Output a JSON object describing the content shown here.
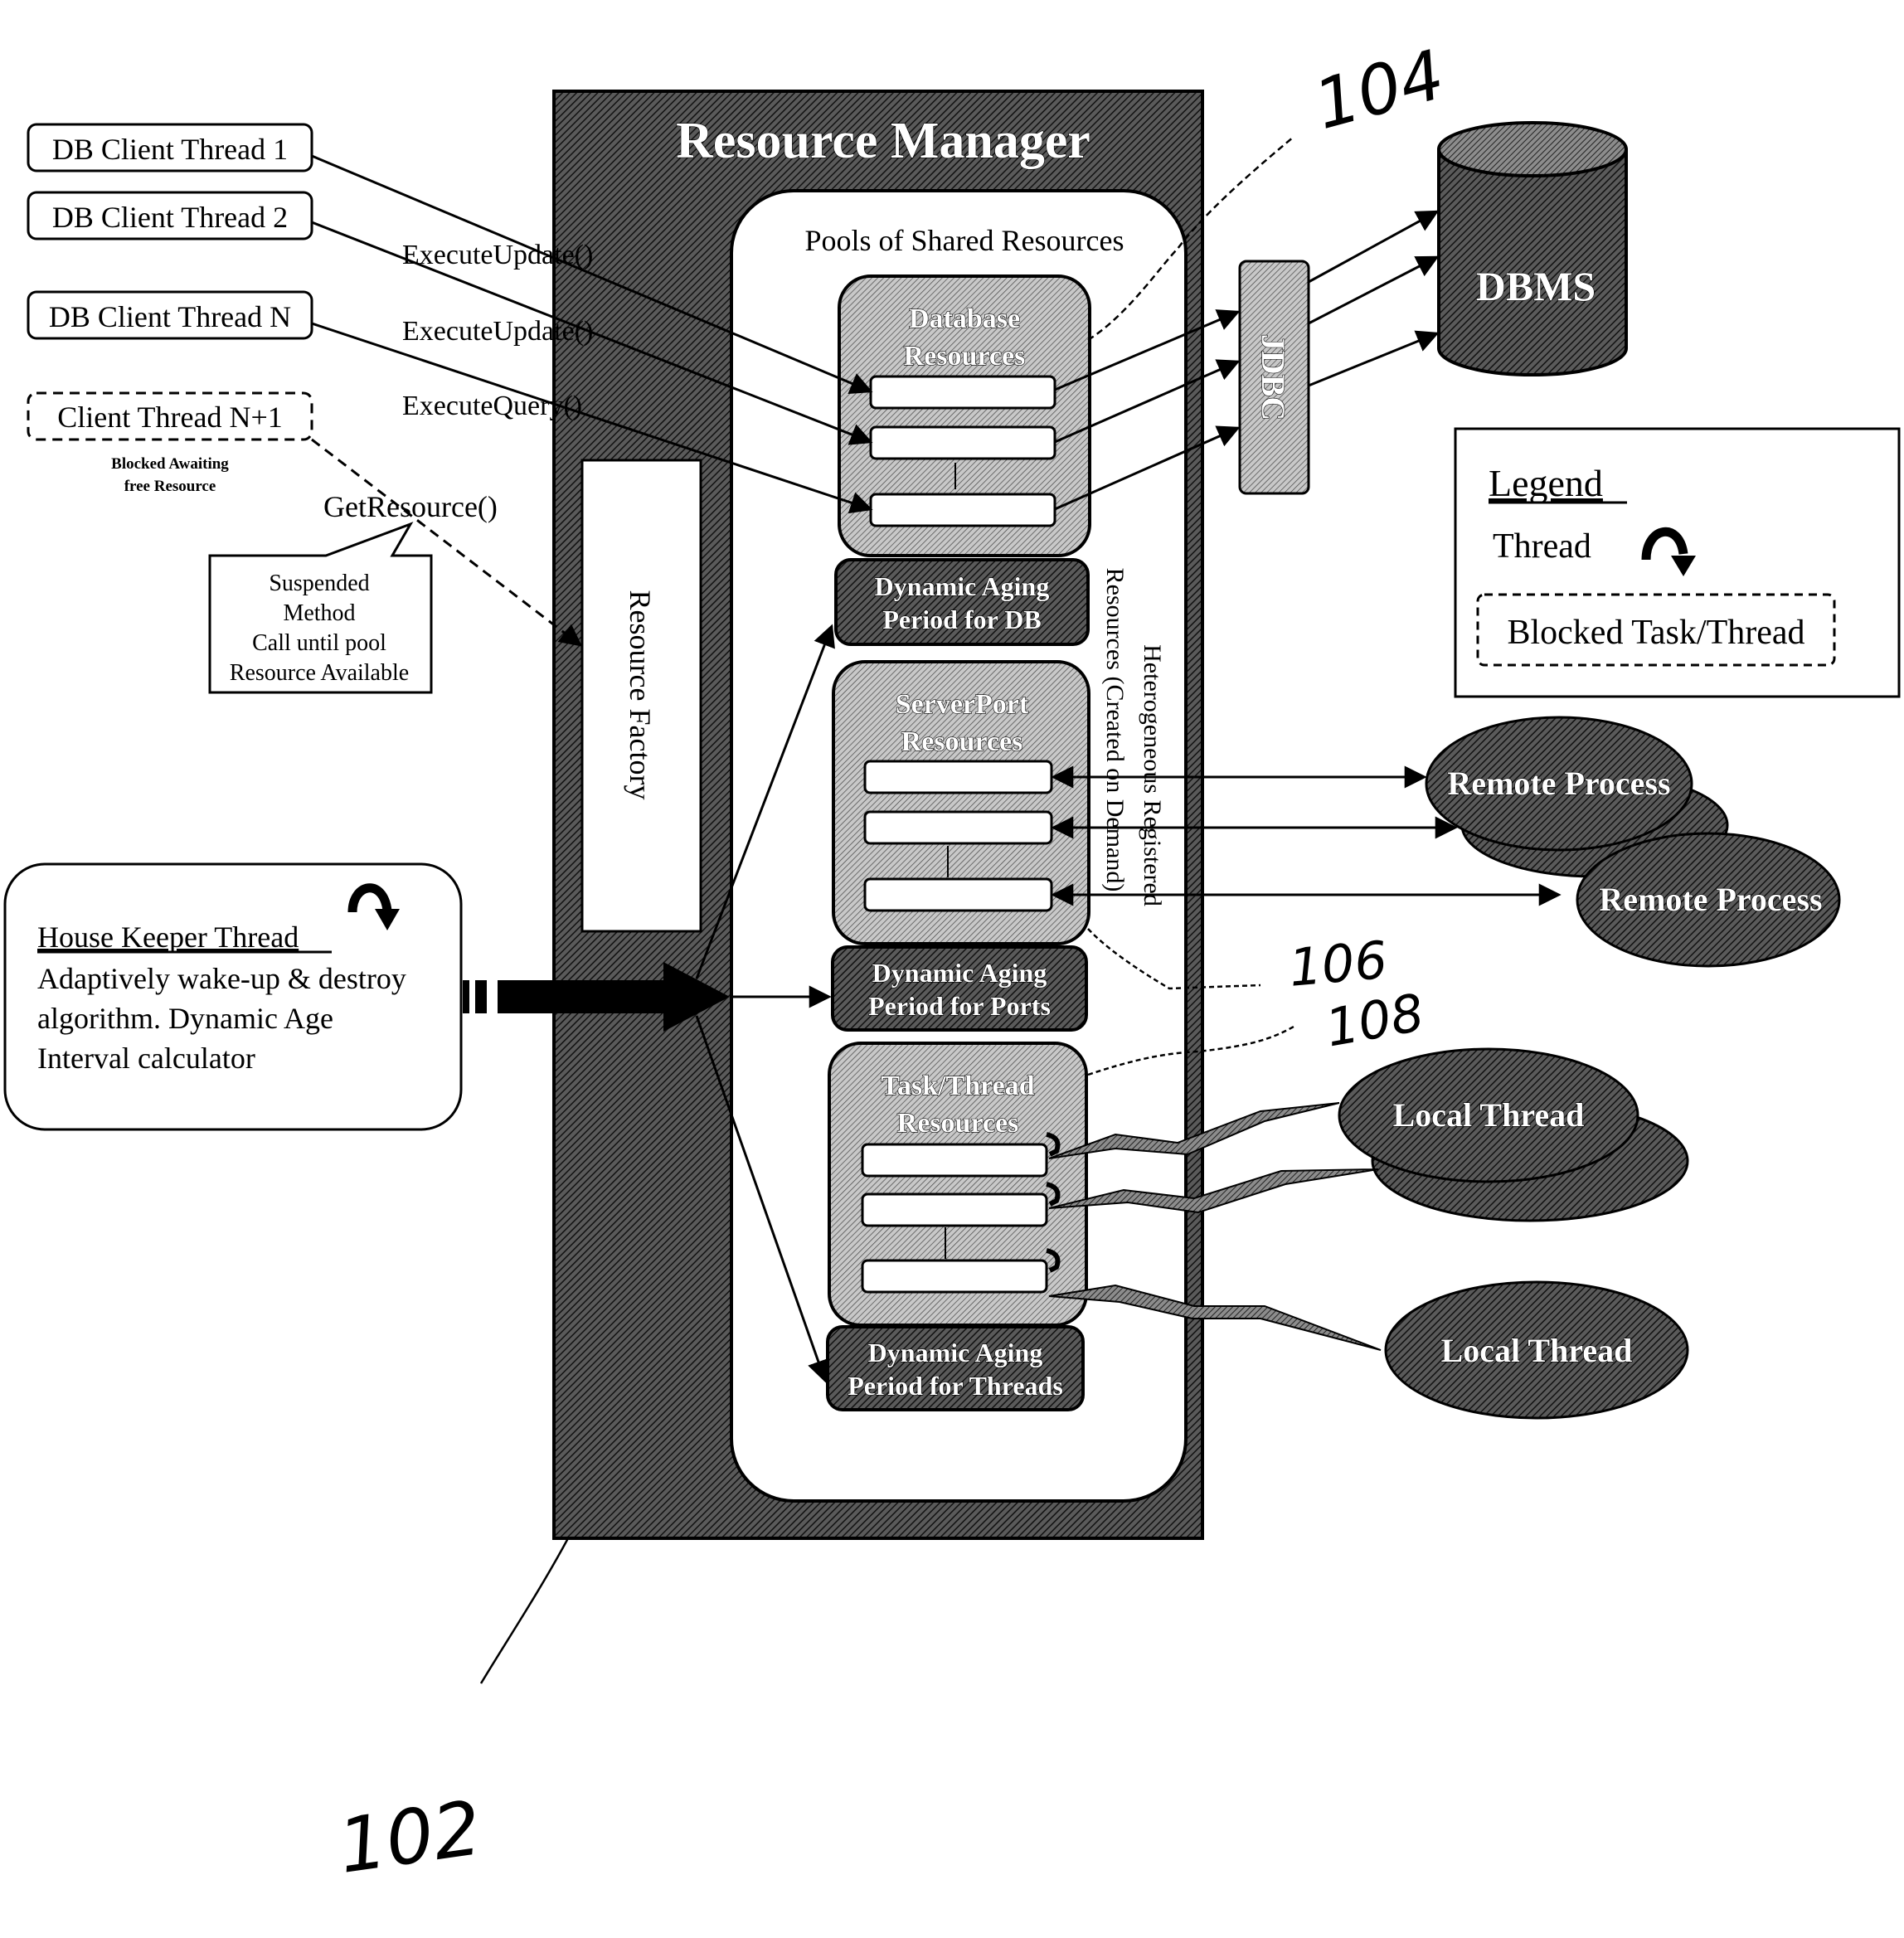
{
  "resource_manager": {
    "title": "Resource Manager",
    "pools_title": "Pools of Shared Resources",
    "factory_label": "Resource Factory",
    "heterogeneous_label_line1": "Heterogeneous Registered",
    "heterogeneous_label_line2": "Resources (Created on Demand)"
  },
  "clients": [
    {
      "label": "DB Client Thread 1",
      "call": "ExecuteUpdate()"
    },
    {
      "label": "DB Client Thread 2",
      "call": "ExecuteUpdate()"
    },
    {
      "label": "DB Client Thread N",
      "call": "ExecuteQuery()"
    }
  ],
  "blocked_client": {
    "label": "Client Thread N+1",
    "note_line1": "Blocked Awaiting",
    "note_line2": "free Resource",
    "call": "GetResource()"
  },
  "callout": {
    "lines": [
      "Suspended",
      "Method",
      "Call until pool",
      "Resource Available"
    ]
  },
  "pools": [
    {
      "title_line1": "Database",
      "title_line2": "Resources",
      "aging_line1": "Dynamic Aging",
      "aging_line2": "Period for DB"
    },
    {
      "title_line1": "ServerPort",
      "title_line2": "Resources",
      "aging_line1": "Dynamic Aging",
      "aging_line2": "Period for Ports"
    },
    {
      "title_line1": "Task/Thread",
      "title_line2": "Resources",
      "aging_line1": "Dynamic Aging",
      "aging_line2": "Period for Threads"
    }
  ],
  "jdbc_label": "JDBC",
  "dbms_label": "DBMS",
  "remote_processes": [
    "Remote Process",
    "Remote Process"
  ],
  "local_threads": [
    "Local Thread",
    "Local Thread"
  ],
  "housekeeper": {
    "title": "House Keeper Thread",
    "lines": [
      "Adaptively wake-up & destroy",
      "algorithm.  Dynamic Age",
      "Interval calculator"
    ]
  },
  "legend": {
    "title": "Legend",
    "thread_label": "Thread",
    "blocked_label": "Blocked Task/Thread"
  },
  "reference_numerals": {
    "rm": "102",
    "db_pool": "104",
    "port_pool": "106",
    "thread_pool": "108"
  },
  "colors": {
    "hatch_dark": "#3a3a3a",
    "hatch_light": "#9a9a9a",
    "ink": "#000000",
    "paper": "#ffffff"
  }
}
